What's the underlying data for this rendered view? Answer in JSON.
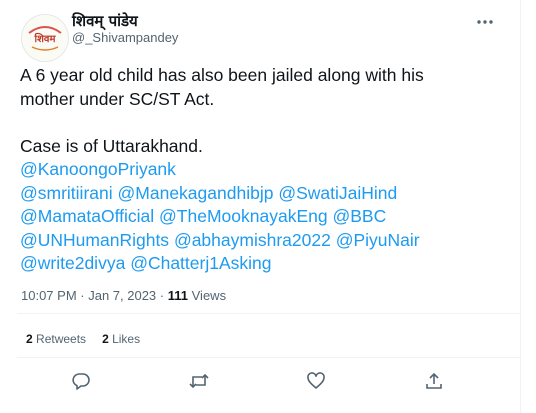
{
  "tweet": {
    "author": {
      "display_name": "शिवम् पांडेय",
      "handle": "@_Shivampandey",
      "avatar_text": "शिवम"
    },
    "text_lines": [
      "A 6 year old child has also been jailed along with his",
      "mother under SC/ST Act."
    ],
    "text_line3": "Case is of Uttarakhand.",
    "mentions": [
      "@KanoongoPriyank",
      "@smritiirani",
      "@Manekagandhibjp",
      "@SwatiJaiHind",
      "@MamataOfficial",
      "@TheMooknayakEng",
      "@BBC",
      "@UNHumanRights",
      "@abhaymishra2022",
      "@PiyuNair",
      "@write2divya",
      "@Chatterj1Asking"
    ],
    "time": "10:07 PM",
    "date": "Jan 7, 2023",
    "views_count": "111",
    "views_label": "Views",
    "retweets_count": "2",
    "retweets_label": "Retweets",
    "likes_count": "2",
    "likes_label": "Likes"
  },
  "icons": {
    "more": "more-horizontal-icon",
    "reply": "reply-icon",
    "retweet": "retweet-icon",
    "like": "heart-icon",
    "share": "share-icon"
  },
  "colors": {
    "link": "#1d9bf0",
    "text": "#0f1419",
    "secondary": "#536471",
    "divider": "#eff3f4"
  }
}
